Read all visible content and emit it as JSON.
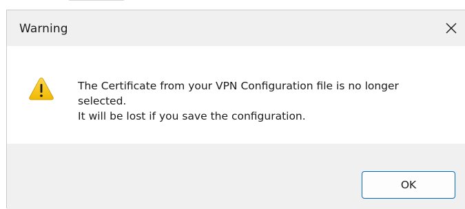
{
  "dialog": {
    "title": "Warning",
    "close_icon": "close-icon",
    "icon": "warning-icon",
    "message_lines": [
      "The Certificate from your VPN Configuration file is no longer",
      "selected.",
      "It will be lost if you save the configuration."
    ],
    "ok_label": "OK"
  },
  "colors": {
    "accent_border": "#0067c0",
    "warning_fill": "#f2c100",
    "title_bar_bg": "#f0f0f0"
  }
}
